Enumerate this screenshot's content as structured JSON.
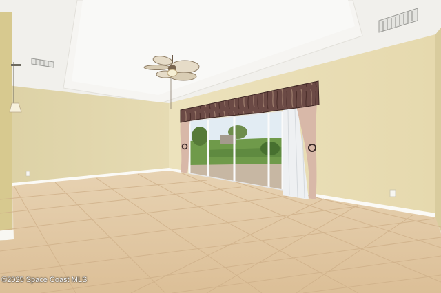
{
  "watermark": "©2025 Space Coast MLS",
  "colors": {
    "wall": "#e8dcb4",
    "ceiling": "#f4f3ef",
    "tile": "#e2c8a4",
    "grout": "#cfb089",
    "baseboard": "#fbfaf6",
    "valance": "#6b4a45",
    "curtain": "#d8b8a8",
    "sheer": "#eef0f2",
    "lawn": "#6f9a4a",
    "sky": "#dfeaf2"
  },
  "icons": {
    "ceiling_fan": "ceiling-fan-icon",
    "light": "pendant-light-icon",
    "vent": "air-vent-icon",
    "outlet": "wall-outlet-icon"
  }
}
